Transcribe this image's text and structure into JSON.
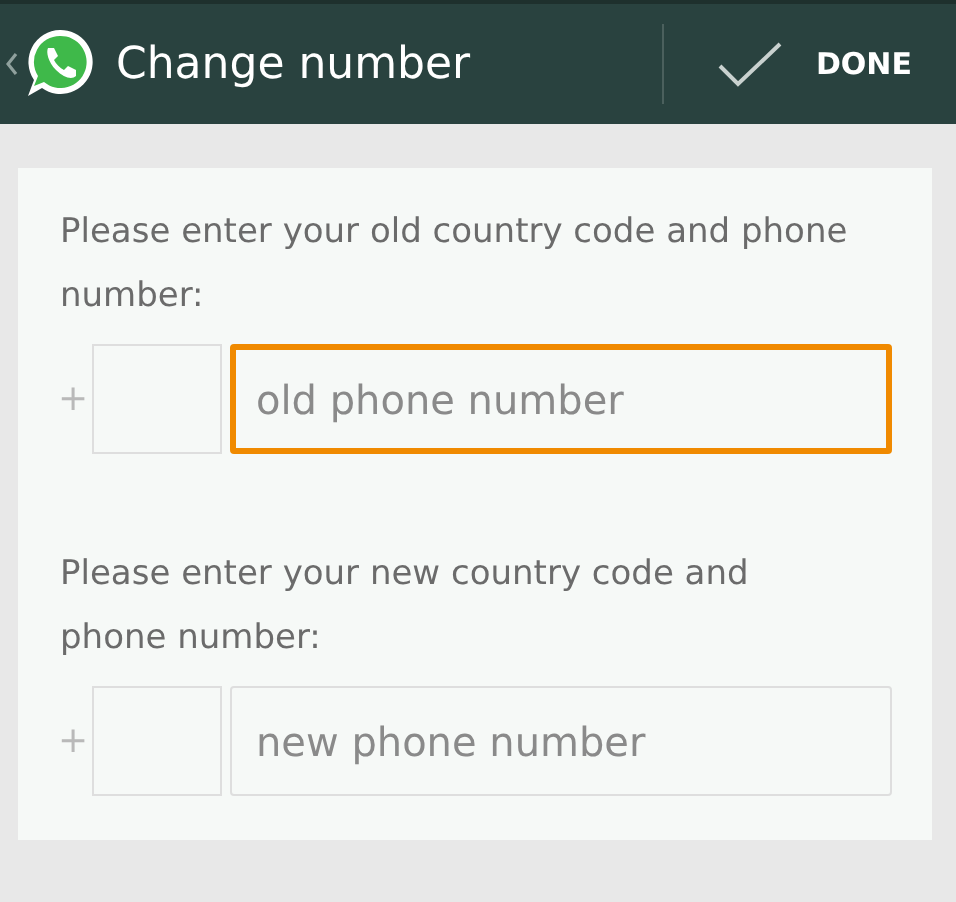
{
  "header": {
    "title": "Change number",
    "done_label": "DONE"
  },
  "sections": [
    {
      "prompt": "Please enter your old country code and phone number:",
      "plus": "+",
      "number_placeholder": "old phone number",
      "focused": true
    },
    {
      "prompt": "Please enter your new country code and phone number:",
      "plus": "+",
      "number_placeholder": "new phone number",
      "focused": false
    }
  ]
}
